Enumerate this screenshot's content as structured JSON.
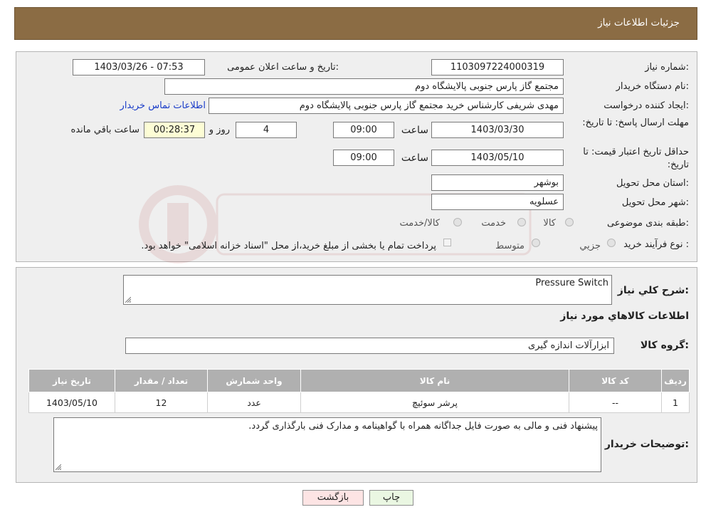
{
  "header": {
    "title": "جزئیات اطلاعات نیاز"
  },
  "form": {
    "need_number_label": "شماره نیاز:",
    "need_number": "1103097224000319",
    "announce_label": "تاریخ و ساعت اعلان عمومی:",
    "announce_value": "1403/03/26 - 07:53",
    "buyer_label": "نام دستگاه خریدار:",
    "buyer_value": "مجتمع گاز پارس جنوبی  پالایشگاه دوم",
    "requester_label": "ایجاد کننده درخواست:",
    "requester_value": "مهدی شریفی کارشناس خرید مجتمع گاز پارس جنوبی  پالایشگاه دوم",
    "contact_link": "اطلاعات تماس خریدار",
    "deadline_label": "مهلت ارسال پاسخ: تا تاریخ:",
    "deadline_date": "1403/03/30",
    "time_label": "ساعت",
    "deadline_time": "09:00",
    "days_value": "4",
    "days_label": "روز و",
    "remaining_value": "00:28:37",
    "remaining_label": "ساعت باقي مانده",
    "validity_label": "حداقل تاریخ اعتبار قیمت: تا تاریخ:",
    "validity_date": "1403/05/10",
    "validity_time": "09:00",
    "province_label": "استان محل تحویل:",
    "province_value": "بوشهر",
    "city_label": "شهر محل تحویل:",
    "city_value": "عسلویه",
    "category_label": "طبقه بندی موضوعی:",
    "category_options": [
      "کالا",
      "خدمت",
      "کالا/خدمت"
    ],
    "process_label": "نوع فرآیند خرید :",
    "process_options": [
      "جزیي",
      "متوسط"
    ],
    "payment_note": "پرداخت تمام یا بخشی از مبلغ خرید،از محل \"اسناد خزانه اسلامی\" خواهد بود."
  },
  "details": {
    "summary_label": "شرح کلي نياز:",
    "summary_value": "Pressure Switch",
    "items_heading": "اطلاعات کالاهاي مورد نياز",
    "group_label": "گروه کالا:",
    "group_value": "ابزارآلات اندازه گیری",
    "table": {
      "headers": [
        "ردیف",
        "کد کالا",
        "نام کالا",
        "واحد شمارش",
        "تعداد / مقدار",
        "تاریخ نیاز"
      ],
      "rows": [
        [
          "1",
          "--",
          "پرشر سوئیچ",
          "عدد",
          "12",
          "1403/05/10"
        ]
      ]
    },
    "buyer_notes_label": "توضیحات خریدار:",
    "buyer_notes_value": "پیشنهاد فنی و مالی به صورت فایل جداگانه همراه با گواهینامه و مدارک فنی بارگذاری گردد."
  },
  "buttons": {
    "print": "چاپ",
    "back": "بازگشت"
  },
  "colors": {
    "header_bg": "#8b6c44",
    "panel_bg": "#efefef",
    "back_button_bg": "#fde4e4",
    "print_button_bg": "#eaf7e2"
  }
}
